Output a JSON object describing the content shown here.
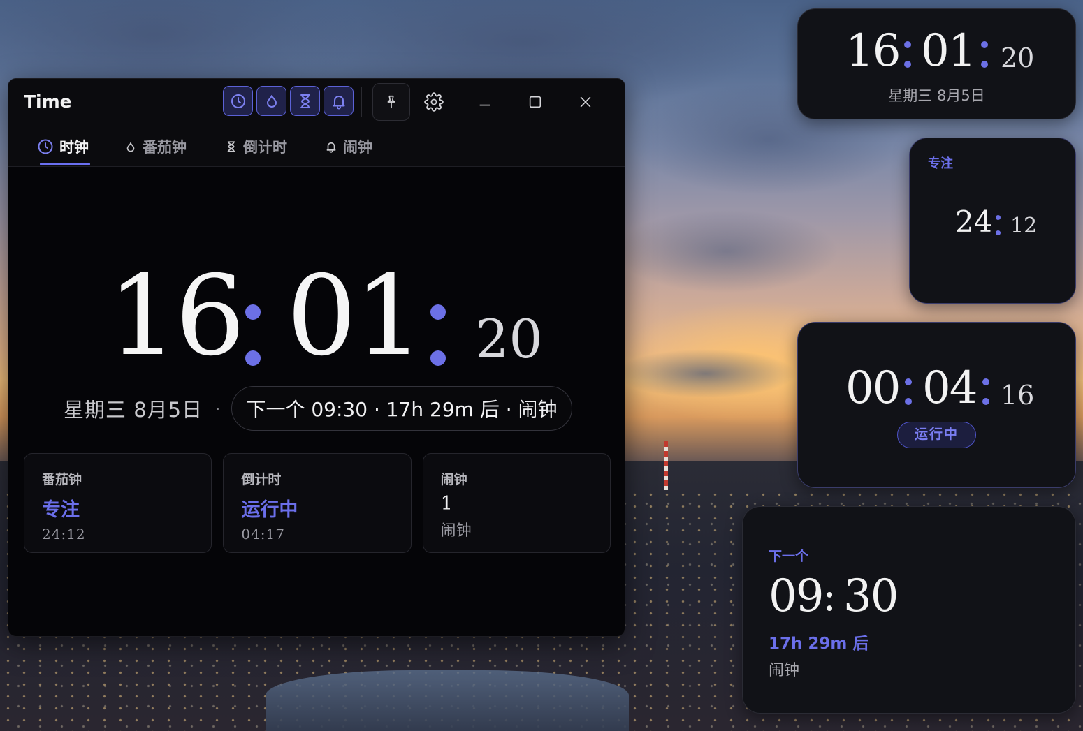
{
  "window": {
    "title": "Time",
    "mode_buttons": [
      {
        "name": "clock",
        "icon": "clock-icon"
      },
      {
        "name": "pomodoro",
        "icon": "drop-icon"
      },
      {
        "name": "countdown",
        "icon": "hourglass-icon"
      },
      {
        "name": "alarm",
        "icon": "bell-icon"
      }
    ],
    "controls": [
      "pin-icon",
      "gear-icon",
      "minimize-icon",
      "maximize-icon",
      "close-icon"
    ]
  },
  "tabs": [
    {
      "label": "时钟",
      "icon": "clock-icon",
      "active": true
    },
    {
      "label": "番茄钟",
      "icon": "drop-icon",
      "active": false
    },
    {
      "label": "倒计时",
      "icon": "hourglass-icon",
      "active": false
    },
    {
      "label": "闹钟",
      "icon": "bell-icon",
      "active": false
    }
  ],
  "clock": {
    "hours": "16",
    "minutes": "01",
    "seconds": "20",
    "date": "星期三 8月5日",
    "separator": "·",
    "next_alarm": "下一个 09:30 · 17h 29m 后 · 闹钟"
  },
  "cards": {
    "pomodoro": {
      "title": "番茄钟",
      "state": "专注",
      "time": "24:12"
    },
    "countdown": {
      "title": "倒计时",
      "state": "运行中",
      "time": "04:17"
    },
    "alarm": {
      "title": "闹钟",
      "count": "1",
      "sub": "闹钟"
    }
  },
  "widgets": {
    "clock": {
      "hours": "16",
      "minutes": "01",
      "seconds": "20",
      "date": "星期三 8月5日"
    },
    "focus": {
      "label": "专注",
      "minutes": "24",
      "seconds": "12"
    },
    "timer": {
      "hours": "00",
      "minutes": "04",
      "seconds": "16",
      "badge": "运行中"
    },
    "next": {
      "label": "下一个",
      "hours": "09",
      "minutes": "30",
      "relative": "17h 29m 后",
      "kind": "闹钟"
    }
  },
  "colors": {
    "accent": "#6c70e6",
    "window_bg": "#050508",
    "widget_bg": "#111217"
  }
}
